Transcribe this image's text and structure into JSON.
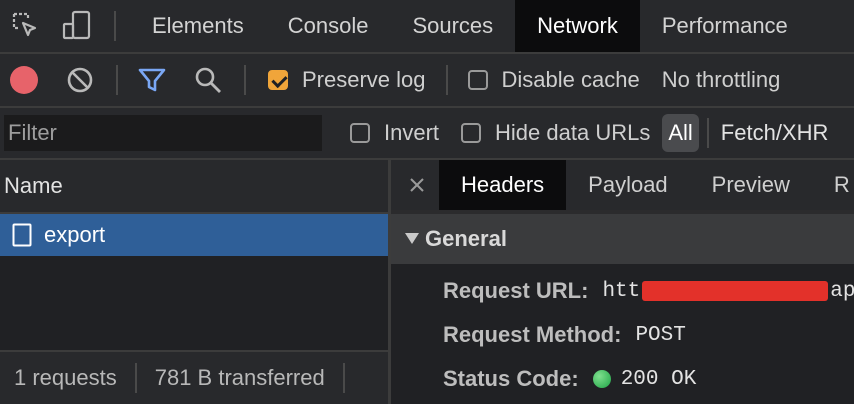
{
  "tabs": [
    {
      "label": "Elements"
    },
    {
      "label": "Console"
    },
    {
      "label": "Sources"
    },
    {
      "label": "Network"
    },
    {
      "label": "Performance"
    }
  ],
  "toolbar": {
    "preserve_log": {
      "label": "Preserve log",
      "checked": true
    },
    "disable_cache": {
      "label": "Disable cache",
      "checked": false
    },
    "throttling": "No throttling"
  },
  "filter": {
    "placeholder": "Filter",
    "invert": "Invert",
    "hide_data_urls": "Hide data URLs",
    "type_all": "All",
    "type_fetch": "Fetch/XHR"
  },
  "requests": {
    "header": "Name",
    "items": [
      {
        "name": "export",
        "selected": true
      }
    ],
    "status_requests": "1 requests",
    "status_transferred": "781 B transferred"
  },
  "details": {
    "tabs": [
      "Headers",
      "Payload",
      "Preview",
      "R"
    ],
    "active_tab": "Headers",
    "section_title": "General",
    "fields": [
      {
        "key": "Request URL:",
        "value_start": "htt",
        "value_end": "ap"
      },
      {
        "key": "Request Method:",
        "value": "POST"
      },
      {
        "key": "Status Code:",
        "value": "200 OK"
      }
    ]
  },
  "colors": {
    "accent_blue": "#2f5f98",
    "record_red": "#e7636a",
    "checkbox_orange": "#f0a53a",
    "status_green": "#1ea446",
    "redaction_red": "#e3312a"
  }
}
